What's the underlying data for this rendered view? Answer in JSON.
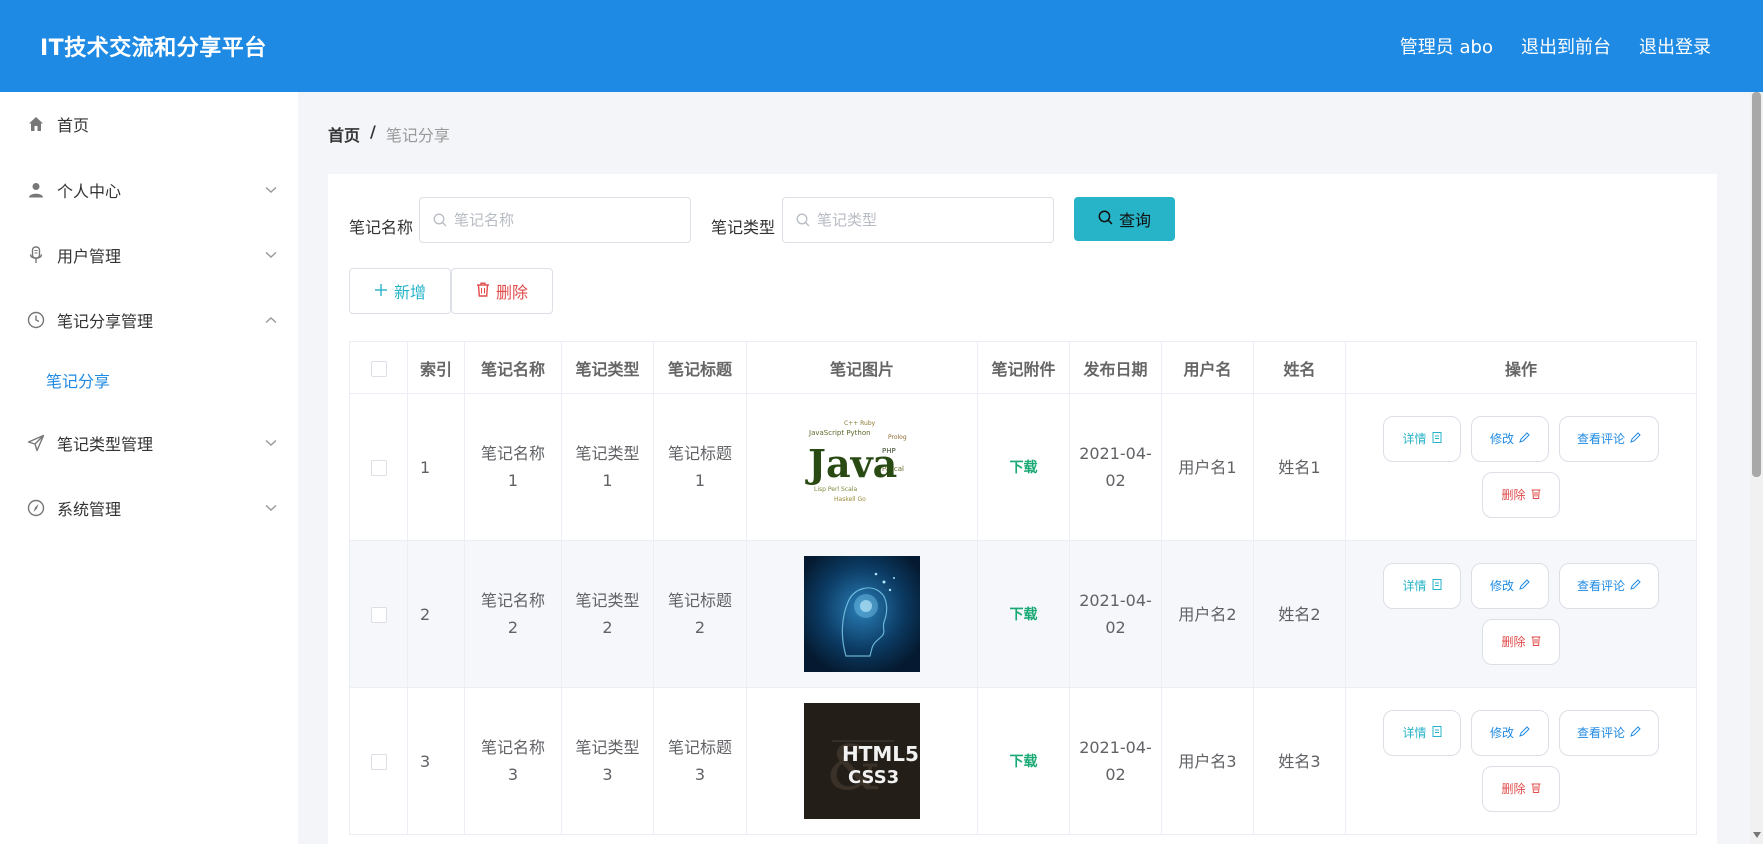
{
  "header": {
    "brand": "IT技术交流和分享平台",
    "admin": "管理员 abo",
    "to_front": "退出到前台",
    "logout": "退出登录"
  },
  "sidebar": {
    "items": [
      {
        "label": "首页",
        "icon": "home-icon"
      },
      {
        "label": "个人中心",
        "icon": "user-icon"
      },
      {
        "label": "用户管理",
        "icon": "microphone-icon"
      },
      {
        "label": "笔记分享管理",
        "icon": "clock-icon"
      },
      {
        "label": "笔记类型管理",
        "icon": "send-icon"
      },
      {
        "label": "系统管理",
        "icon": "compass-icon"
      }
    ],
    "sub_item": "笔记分享"
  },
  "breadcrumb": {
    "home": "首页",
    "sep": "/",
    "current": "笔记分享"
  },
  "search": {
    "name_label": "笔记名称",
    "name_placeholder": "笔记名称",
    "type_label": "笔记类型",
    "type_placeholder": "笔记类型",
    "query": "查询"
  },
  "actions": {
    "add": "新增",
    "delete": "删除"
  },
  "table": {
    "headers": [
      "索引",
      "笔记名称",
      "笔记类型",
      "笔记标题",
      "笔记图片",
      "笔记附件",
      "发布日期",
      "用户名",
      "姓名",
      "操作"
    ],
    "rows": [
      {
        "index": "1",
        "name_line1": "笔记名称",
        "name_line2": "1",
        "type_line1": "笔记类型",
        "type_line2": "1",
        "title_line1": "笔记标题",
        "title_line2": "1",
        "attachment": "下载",
        "date_line1": "2021-04-",
        "date_line2": "02",
        "username": "用户名1",
        "realname": "姓名1",
        "image": "Java word cloud",
        "image_text": "Java"
      },
      {
        "index": "2",
        "name_line1": "笔记名称",
        "name_line2": "2",
        "type_line1": "笔记类型",
        "type_line2": "2",
        "title_line1": "笔记标题",
        "title_line2": "2",
        "attachment": "下载",
        "date_line1": "2021-04-",
        "date_line2": "02",
        "username": "用户名2",
        "realname": "姓名2",
        "image": "AI digital head"
      },
      {
        "index": "3",
        "name_line1": "笔记名称",
        "name_line2": "3",
        "type_line1": "笔记类型",
        "type_line2": "3",
        "title_line1": "笔记标题",
        "title_line2": "3",
        "attachment": "下载",
        "date_line1": "2021-04-",
        "date_line2": "02",
        "username": "用户名3",
        "realname": "姓名3",
        "image": "HTML5 CSS3 book cover",
        "image_text_1": "HTML5",
        "image_text_2": "CSS3"
      }
    ],
    "op_labels": {
      "detail": "详情",
      "edit": "修改",
      "comment": "查看评论",
      "remove": "删除"
    }
  },
  "colors": {
    "header_bg": "#1f8ae3",
    "accent_teal": "#28b4c8",
    "danger": "#e14b4b",
    "success": "#19a974"
  }
}
